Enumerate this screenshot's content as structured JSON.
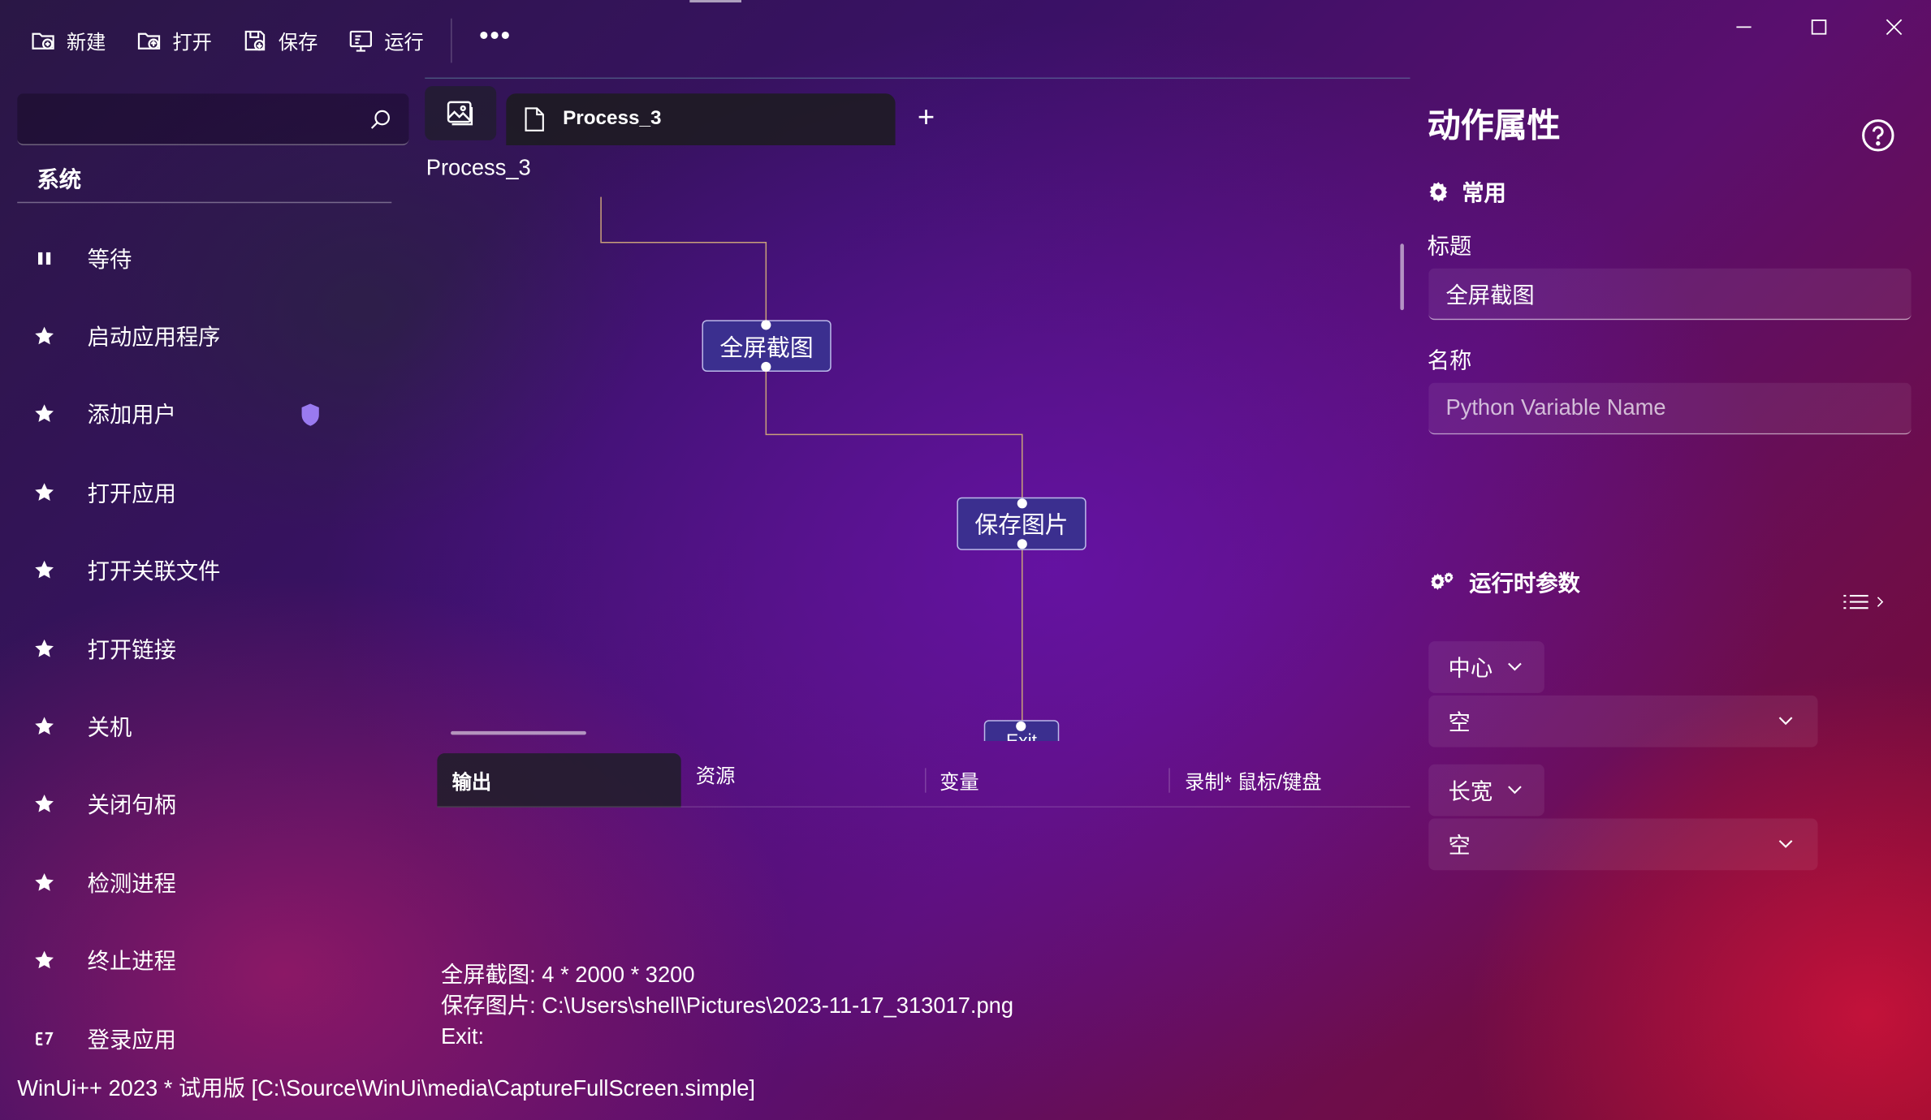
{
  "toolbar": {
    "new_label": "新建",
    "open_label": "打开",
    "save_label": "保存",
    "run_label": "运行",
    "more_label": "•••"
  },
  "sidebar": {
    "search_placeholder": "",
    "section_title": "系统",
    "items": [
      {
        "label": "等待",
        "icon": "pause-icon"
      },
      {
        "label": "启动应用程序",
        "icon": "star-icon"
      },
      {
        "label": "添加用户",
        "icon": "star-icon",
        "badge": "shield-icon"
      },
      {
        "label": "打开应用",
        "icon": "star-icon"
      },
      {
        "label": "打开关联文件",
        "icon": "star-icon"
      },
      {
        "label": "打开链接",
        "icon": "star-icon"
      },
      {
        "label": "关机",
        "icon": "star-icon"
      },
      {
        "label": "关闭句柄",
        "icon": "star-icon"
      },
      {
        "label": "检测进程",
        "icon": "star-icon"
      },
      {
        "label": "终止进程",
        "icon": "star-icon"
      },
      {
        "label": "登录应用",
        "icon": "login-app-icon"
      }
    ]
  },
  "tabs": {
    "doc_tab_label": "Process_3",
    "add_tab_label": "+"
  },
  "canvas": {
    "title": "Process_3",
    "nodes": [
      {
        "label": "全屏截图"
      },
      {
        "label": "保存图片"
      },
      {
        "label": "Exit"
      }
    ]
  },
  "bottom_tabs": [
    "输出",
    "资源",
    "变量",
    "录制* 鼠标/键盘"
  ],
  "output_lines": [
    "全屏截图: 4 * 2000 * 3200",
    "保存图片: C:\\Users\\shell\\Pictures\\2023-11-17_313017.png",
    "Exit:"
  ],
  "status_bar": "WinUi++ 2023 * 试用版 [C:\\Source\\WinUi\\media\\CaptureFullScreen.simple]",
  "properties": {
    "title": "动作属性",
    "common_section": "常用",
    "title_label": "标题",
    "title_value": "全屏截图",
    "name_label": "名称",
    "name_placeholder": "Python Variable Name",
    "runtime_section": "运行时参数",
    "param1_type": "中心",
    "param1_value": "空",
    "param2_type": "长宽",
    "param2_value": "空"
  },
  "colors": {
    "node_fill": "#3b2f8f",
    "shield_badge": "#9a7af0",
    "connector": "#c9a07a"
  }
}
